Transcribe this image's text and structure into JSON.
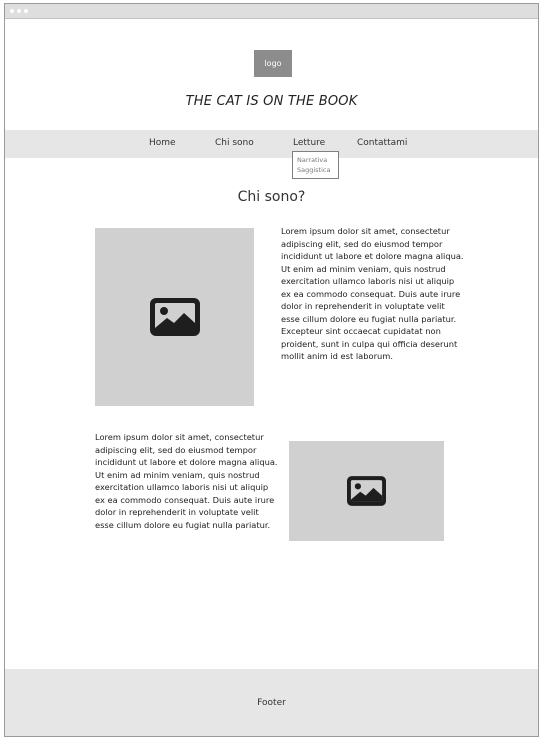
{
  "header": {
    "logo_label": "logo",
    "site_title": "THE CAT IS ON THE BOOK"
  },
  "nav": {
    "items": [
      {
        "label": "Home"
      },
      {
        "label": "Chi sono"
      },
      {
        "label": "Letture"
      },
      {
        "label": "Contattami"
      }
    ],
    "dropdown": {
      "items": [
        {
          "label": "Narrativa"
        },
        {
          "label": "Saggistica"
        }
      ]
    }
  },
  "main": {
    "section_title": "Chi sono?",
    "blocks": [
      {
        "text": "Lorem ipsum dolor sit amet, consectetur adipiscing elit, sed do eiusmod tempor incididunt ut labore et dolore magna aliqua. Ut enim ad minim veniam, quis nostrud exercitation ullamco laboris nisi ut aliquip ex ea commodo consequat. Duis aute irure dolor in reprehenderit in voluptate velit esse cillum dolore eu fugiat nulla pariatur. Excepteur sint occaecat cupidatat non proident, sunt in culpa qui officia deserunt mollit anim id est laborum.",
        "image_icon": "image-icon"
      },
      {
        "text": "Lorem ipsum dolor sit amet, consectetur adipiscing elit, sed do eiusmod tempor incididunt ut labore et dolore magna aliqua. Ut enim ad minim veniam, quis nostrud exercitation ullamco laboris nisi ut aliquip ex ea commodo consequat. Duis aute irure dolor in reprehenderit in voluptate velit esse cillum dolore eu fugiat nulla pariatur.",
        "image_icon": "image-icon"
      }
    ]
  },
  "footer": {
    "label": "Footer"
  },
  "colors": {
    "bar_background": "#e6e6e6",
    "placeholder": "#d0d0d0",
    "logo_box": "#8c8c8c",
    "icon": "#1e1e1e"
  }
}
